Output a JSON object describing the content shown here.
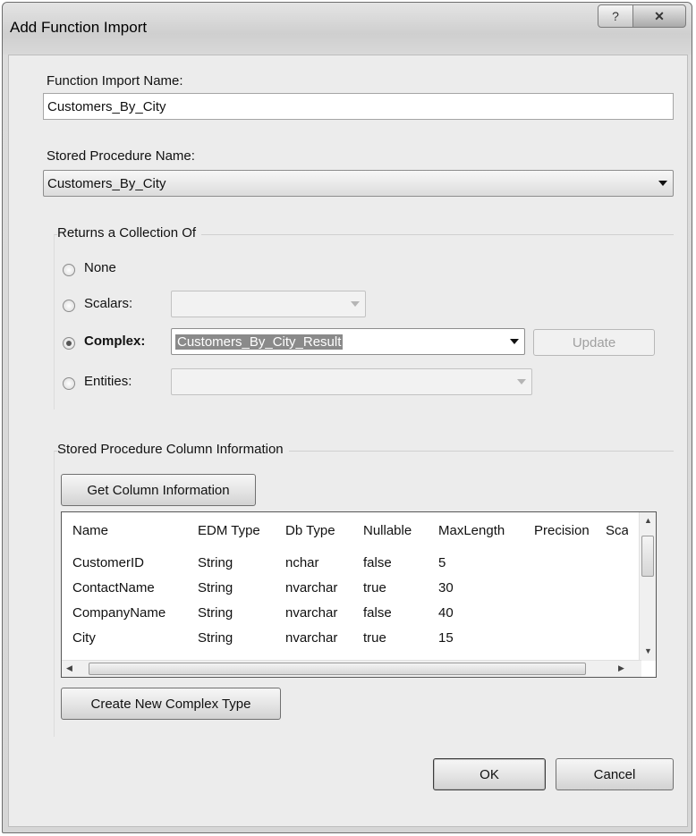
{
  "window": {
    "title": "Add Function Import",
    "help_label": "?",
    "close_label": "✕"
  },
  "function_import": {
    "label": "Function Import Name:",
    "value": "Customers_By_City"
  },
  "stored_procedure": {
    "label": "Stored Procedure Name:",
    "value": "Customers_By_City"
  },
  "returns": {
    "group_label": "Returns a Collection Of",
    "options": [
      {
        "label": "None",
        "selected": false
      },
      {
        "label": "Scalars:",
        "selected": false
      },
      {
        "label": "Complex:",
        "selected": true
      },
      {
        "label": "Entities:",
        "selected": false
      }
    ],
    "scalars_value": "",
    "complex_value": "Customers_By_City_Result",
    "entities_value": "",
    "update_label": "Update"
  },
  "column_info": {
    "group_label": "Stored Procedure Column Information",
    "get_button": "Get Column Information",
    "columns": [
      "Name",
      "EDM Type",
      "Db Type",
      "Nullable",
      "MaxLength",
      "Precision",
      "Sca"
    ],
    "rows": [
      [
        "CustomerID",
        "String",
        "nchar",
        "false",
        "5"
      ],
      [
        "ContactName",
        "String",
        "nvarchar",
        "true",
        "30"
      ],
      [
        "CompanyName",
        "String",
        "nvarchar",
        "false",
        "40"
      ],
      [
        "City",
        "String",
        "nvarchar",
        "true",
        "15"
      ]
    ],
    "create_button": "Create New Complex Type"
  },
  "footer": {
    "ok_label": "OK",
    "cancel_label": "Cancel"
  },
  "icons": [
    "help-icon",
    "close-icon",
    "chevron-down-icon",
    "scroll-up-icon",
    "scroll-down-icon",
    "scroll-left-icon",
    "scroll-right-icon"
  ]
}
